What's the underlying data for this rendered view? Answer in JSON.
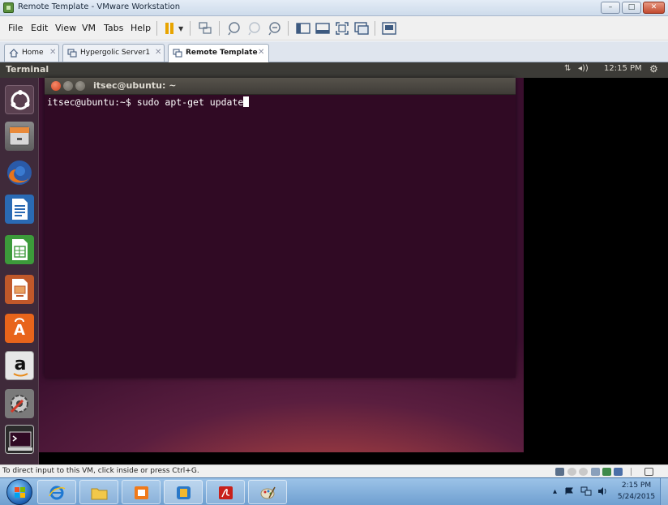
{
  "window": {
    "title": "Remote Template - VMware Workstation",
    "minimize_glyph": "–",
    "maximize_glyph": "□",
    "close_glyph": "✕"
  },
  "menu": {
    "items": [
      "File",
      "Edit",
      "View",
      "VM",
      "Tabs",
      "Help"
    ]
  },
  "tabs": [
    {
      "label": "Home",
      "close": "✕",
      "icon": "home-icon"
    },
    {
      "label": "Hypergolic Server1",
      "close": "✕",
      "icon": "vm-icon"
    },
    {
      "label": "Remote Template",
      "close": "✕",
      "icon": "vm-icon",
      "active": true
    }
  ],
  "ubuntu_panel": {
    "title": "Terminal",
    "network_glyph": "⇅",
    "volume_glyph": "◂))",
    "time": "12:15 PM",
    "gear_glyph": "⚙"
  },
  "terminal": {
    "title": "itsec@ubuntu: ~",
    "prompt": "itsec@ubuntu:~$ ",
    "command": "sudo apt-get update"
  },
  "launcher": {
    "amazon_glyph": "a",
    "software_center_glyph": "A"
  },
  "statusbar": {
    "text": "To direct input to this VM, click inside or press Ctrl+G."
  },
  "taskbar": {
    "time": "2:15 PM",
    "date": "5/24/2015",
    "tray_up_glyph": "▴"
  },
  "colors": {
    "terminal_bg": "#300a24",
    "ubuntu_panel": "#3c3b37",
    "taskbar": "#6f9fd0"
  }
}
